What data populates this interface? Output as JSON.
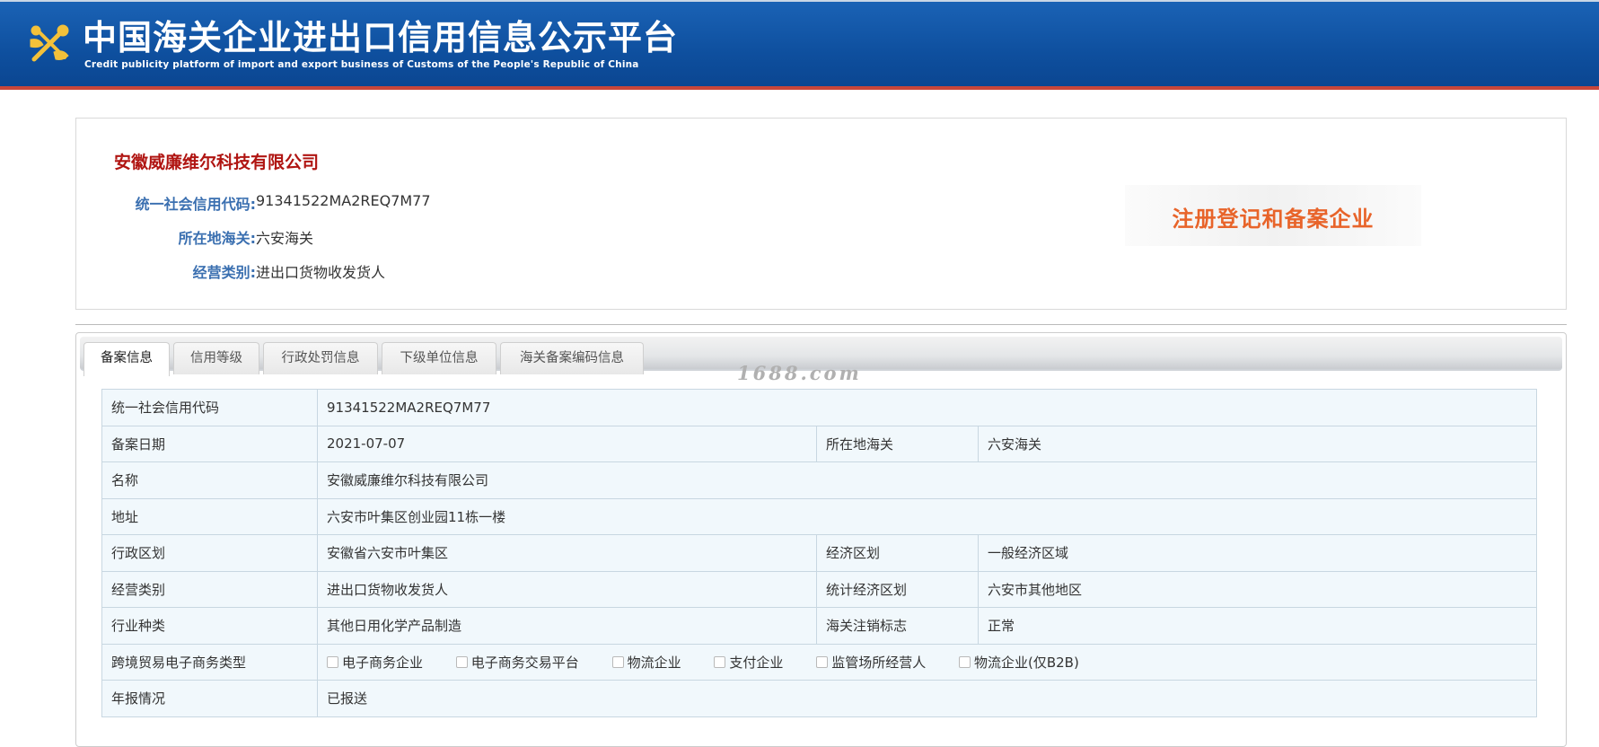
{
  "header": {
    "title_cn": "中国海关企业进出口信用信息公示平台",
    "title_en": "Credit publicity platform of import and export business of Customs of the People's Republic of China",
    "emblem_icon": "customs-emblem-icon"
  },
  "company": {
    "name": "安徽威廉维尔科技有限公司",
    "fields": [
      {
        "label": "统一社会信用代码:",
        "value": "91341522MA2REQ7M77"
      },
      {
        "label": "所在地海关:",
        "value": "六安海关"
      },
      {
        "label": "经营类别:",
        "value": "进出口货物收发货人"
      }
    ],
    "badge": "注册登记和备案企业"
  },
  "tabs": [
    {
      "label": "备案信息",
      "active": true
    },
    {
      "label": "信用等级",
      "active": false
    },
    {
      "label": "行政处罚信息",
      "active": false
    },
    {
      "label": "下级单位信息",
      "active": false
    },
    {
      "label": "海关备案编码信息",
      "active": false
    }
  ],
  "watermark": "1688.com",
  "detail": {
    "credit_code_label": "统一社会信用代码",
    "credit_code_value": "91341522MA2REQ7M77",
    "reg_date_label": "备案日期",
    "reg_date_value": "2021-07-07",
    "customs_label": "所在地海关",
    "customs_value": "六安海关",
    "name_label": "名称",
    "name_value": "安徽威廉维尔科技有限公司",
    "address_label": "地址",
    "address_value": "六安市叶集区创业园11栋一楼",
    "admin_region_label": "行政区划",
    "admin_region_value": "安徽省六安市叶集区",
    "econ_region_label": "经济区划",
    "econ_region_value": "一般经济区域",
    "business_type_label": "经营类别",
    "business_type_value": "进出口货物收发货人",
    "stat_region_label": "统计经济区划",
    "stat_region_value": "六安市其他地区",
    "industry_label": "行业种类",
    "industry_value": "其他日用化学产品制造",
    "cancel_flag_label": "海关注销标志",
    "cancel_flag_value": "正常",
    "ecommerce_label": "跨境贸易电子商务类型",
    "ecommerce_options": [
      "电子商务企业",
      "电子商务交易平台",
      "物流企业",
      "支付企业",
      "监管场所经营人",
      "物流企业(仅B2B)"
    ],
    "annual_report_label": "年报情况",
    "annual_report_value": "已报送"
  },
  "colors": {
    "header_blue": "#0e4f9e",
    "company_red": "#b01512",
    "label_blue": "#3a6fb0",
    "badge_orange": "#e8642a",
    "table_bg": "#f1f8fc"
  }
}
